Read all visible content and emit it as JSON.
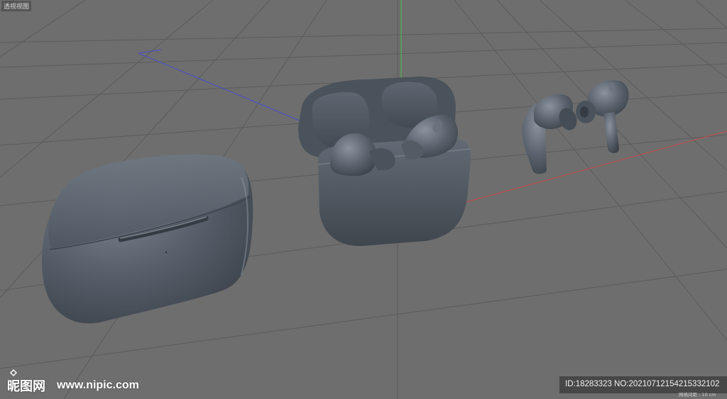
{
  "viewport": {
    "title": "透视视图",
    "grid_scale": "网格间距 : 10 cm"
  },
  "scene": {
    "objects": [
      {
        "name": "closed-case"
      },
      {
        "name": "open-case-with-earbuds"
      },
      {
        "name": "loose-earbud-pair"
      }
    ],
    "axes": {
      "x_color": "#c94a4a",
      "y_color": "#4fbf4f",
      "z_color": "#4b4bd0"
    },
    "background_color": "#6e6e6e",
    "model_color": "#56606b"
  },
  "watermark": {
    "brand": "昵图网",
    "site": "www.nipic.com",
    "id_text": "ID:18283323 NO:20210712154215332102"
  }
}
